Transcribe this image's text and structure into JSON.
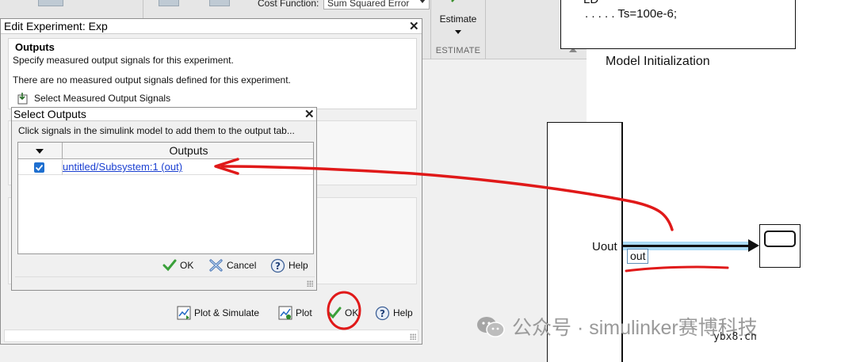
{
  "toolstrip": {
    "cost_function_label": "Cost Function:",
    "cost_function_value": "Sum Squared Error",
    "estimate_label": "Estimate",
    "section_label": "ESTIMATE"
  },
  "canvas": {
    "ts_text": ". . . . . Ts=100e-6;",
    "model_init_label": "Model Initialization",
    "uout_label": "Uout",
    "signal_label": "out"
  },
  "edit_experiment": {
    "title": "Edit Experiment: Exp",
    "outputs_heading": "Outputs",
    "outputs_desc": "Specify measured output signals for this experiment.",
    "no_outputs_text": "There are no measured output signals defined for this experiment.",
    "select_button": "Select Measured Output Signals",
    "plot_simulate": "Plot & Simulate",
    "plot": "Plot",
    "ok": "OK",
    "help": "Help"
  },
  "select_outputs": {
    "title": "Select Outputs",
    "instruction": "Click signals in the simulink model to add them to the output tab...",
    "column_header": "Outputs",
    "rows": [
      {
        "checked": true,
        "signal": "untitled/Subsystem:1 (out)"
      }
    ],
    "ok": "OK",
    "cancel": "Cancel",
    "help": "Help"
  },
  "watermark": {
    "text": "公众号 · simulinker赛博科技",
    "site": "ybx8.cn"
  },
  "colors": {
    "annotation_red": "#e01919",
    "link_blue": "#1a3fd1",
    "signal_highlight": "#7fc8f0"
  }
}
